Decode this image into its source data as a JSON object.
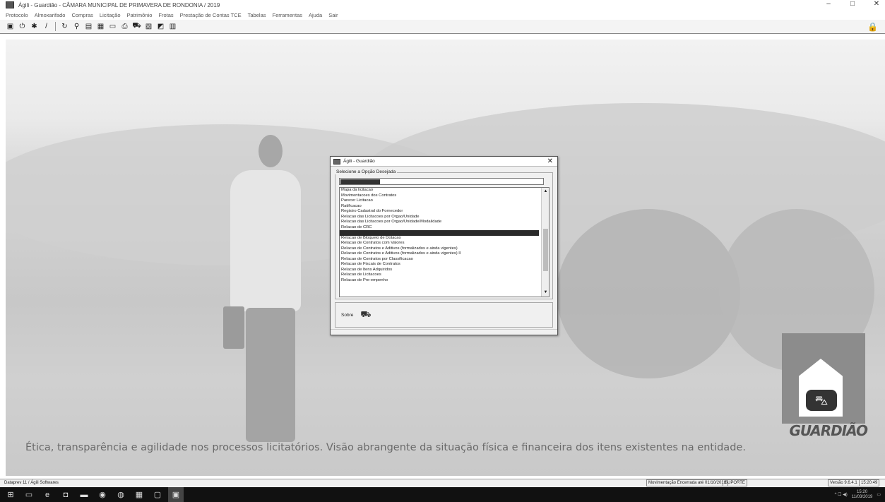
{
  "window": {
    "title": "Ágili - Guardião - CÂMARA MUNICIPAL DE PRIMAVERA DE RONDONIA / 2019",
    "controls": [
      "–",
      "□",
      "✕"
    ]
  },
  "menu": [
    "Protocolo",
    "Almoxarifado",
    "Compras",
    "Licitação",
    "Patrimônio",
    "Frotas",
    "Prestação de Contas TCE",
    "Tabelas",
    "Ferramentas",
    "Ajuda",
    "Sair"
  ],
  "toolbar": {
    "icons": [
      "form-icon",
      "power-icon",
      "tools-icon",
      "pen-icon",
      "refresh-icon",
      "search-icon",
      "document-icon",
      "document-arrow-icon",
      "inbox-icon",
      "print-icon",
      "truck-icon",
      "report-icon",
      "chart-icon",
      "calculator-icon",
      "lock-icon"
    ]
  },
  "dialog": {
    "title": "Ágili - Guardião",
    "close": "✕",
    "group_label": "Selecione a Opção Desejada",
    "search_value": "",
    "list_items": [
      "Mapa da licitacao",
      "Movimentacoes dos Contratos",
      "Parecer Licitacao",
      "Ratificacao",
      "Registro Cadastral do Fornecedor",
      "Relacao das Licitacoes por Orgao/Unidade",
      "Relacao das Licitacoes por Orgao/Unidade/Modalidade",
      "Relacao de CRC",
      "",
      "Relacao de Bloqueio de Dotacao",
      "Relacao de Contratos com Valores",
      "Relacao de Contratos e Aditivos (formalizados e ainda vigentes)",
      "Relacao de Contratos e Aditivos (formalizados e ainda vigentes) II",
      "Relacao de Contratos por Classificacao",
      "Relacao de Fiscais de Contratos",
      "Relacao de Itens Adquiridos",
      "Relacao de Licitacoes",
      "Relacao de Pre-empenho"
    ],
    "selected_index": 8,
    "button_label": "Sobre",
    "scroll_up": "▲",
    "scroll_down": "▼"
  },
  "branding": {
    "logo_text": "GUARDIÃO",
    "tagline": "Ética, transparência e agilidade nos processos licitatórios. Visão abrangente da situação física e financeira dos itens existentes na entidade."
  },
  "statusbar": {
    "left": "Dataprev 11 / Ágili Softwares",
    "movement": "Movimentação Encerrada até 01/10/2018",
    "user": "SUPORTE",
    "version": "Versão 9.6.4.1",
    "time": "15:20:49"
  },
  "taskbar": {
    "tray_text": "^  ☐  ◀)",
    "clock_time": "15:20",
    "clock_date": "11/03/2019"
  }
}
